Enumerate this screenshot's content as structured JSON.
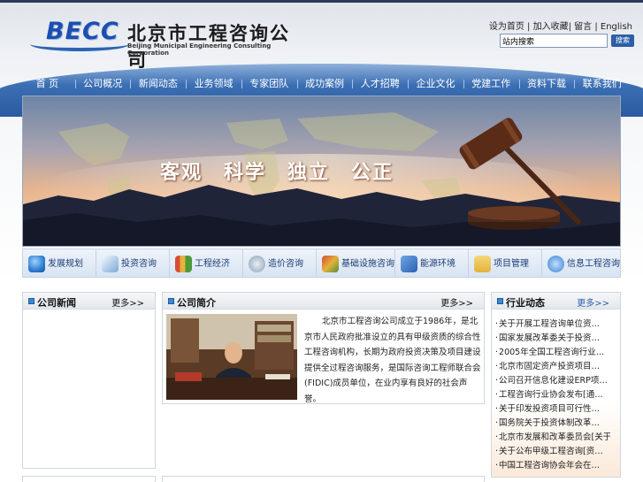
{
  "header": {
    "logo_mark": "BECC",
    "logo_cn": "北京市工程咨询公司",
    "logo_en": "Beijing Municipal Engineering Consulting Corporation",
    "links": [
      "设为首页",
      "加入收藏",
      "留言",
      "English"
    ],
    "separators": [
      " | ",
      "| ",
      " | "
    ],
    "search": {
      "value": "站内搜索",
      "button": "搜索"
    }
  },
  "nav": {
    "items": [
      "首 页",
      "公司概况",
      "新闻动态",
      "业务领域",
      "专家团队",
      "成功案例",
      "人才招聘",
      "企业文化",
      "党建工作",
      "资料下载",
      "联系我们"
    ]
  },
  "banner": {
    "slogan": "客观　科学　独立　公正"
  },
  "categories": [
    {
      "label": "发展规划",
      "icon": "globe-icon",
      "color": "#2f7fd0"
    },
    {
      "label": "投资咨询",
      "icon": "document-icon",
      "color": "#7aa9d8"
    },
    {
      "label": "工程经济",
      "icon": "bar-chart-icon",
      "color": "#d84a3a"
    },
    {
      "label": "造价咨询",
      "icon": "coins-icon",
      "color": "#8a9fb8"
    },
    {
      "label": "基础设施咨询",
      "icon": "infrastructure-icon",
      "color": "#5a8f3a"
    },
    {
      "label": "能源环境",
      "icon": "energy-icon",
      "color": "#2a5fb0"
    },
    {
      "label": "项目管理",
      "icon": "folder-icon",
      "color": "#e2b23a"
    },
    {
      "label": "信息工程咨询",
      "icon": "ie-icon",
      "color": "#3a7fd0"
    }
  ],
  "panels": {
    "left": {
      "title": "公司新闻",
      "more": "更多>>"
    },
    "center": {
      "title": "公司简介",
      "more": "更多>>",
      "intro": "北京市工程咨询公司成立于1986年，是北京市人民政府批准设立的具有甲级资质的综合性工程咨询机构，长期为政府投资决策及项目建设提供全过程咨询服务，是国际咨询工程师联合会(FIDIC)成员单位，在业内享有良好的社会声誉。"
    },
    "right": {
      "title": "行业动态",
      "more": "更多>>",
      "items": [
        "关于开展工程咨询单位资…",
        "国家发展改革委关于投资…",
        "2005年全国工程咨询行业…",
        "北京市固定资产投资项目…",
        "公司召开信息化建设ERP项…",
        "工程咨询行业协会发布[通…",
        "关于印发投资项目可行性…",
        "国务院关于投资体制改革…",
        "北京市发展和改革委员会[关于…",
        "关于公布甲级工程咨询[资…",
        "中国工程咨询协会年会在…"
      ]
    }
  },
  "colors": {
    "nav": "#3b6fb4",
    "accent": "#2a62b0",
    "banner_sky_top": "#6d84a6",
    "banner_sky_mid": "#e7b58f"
  }
}
